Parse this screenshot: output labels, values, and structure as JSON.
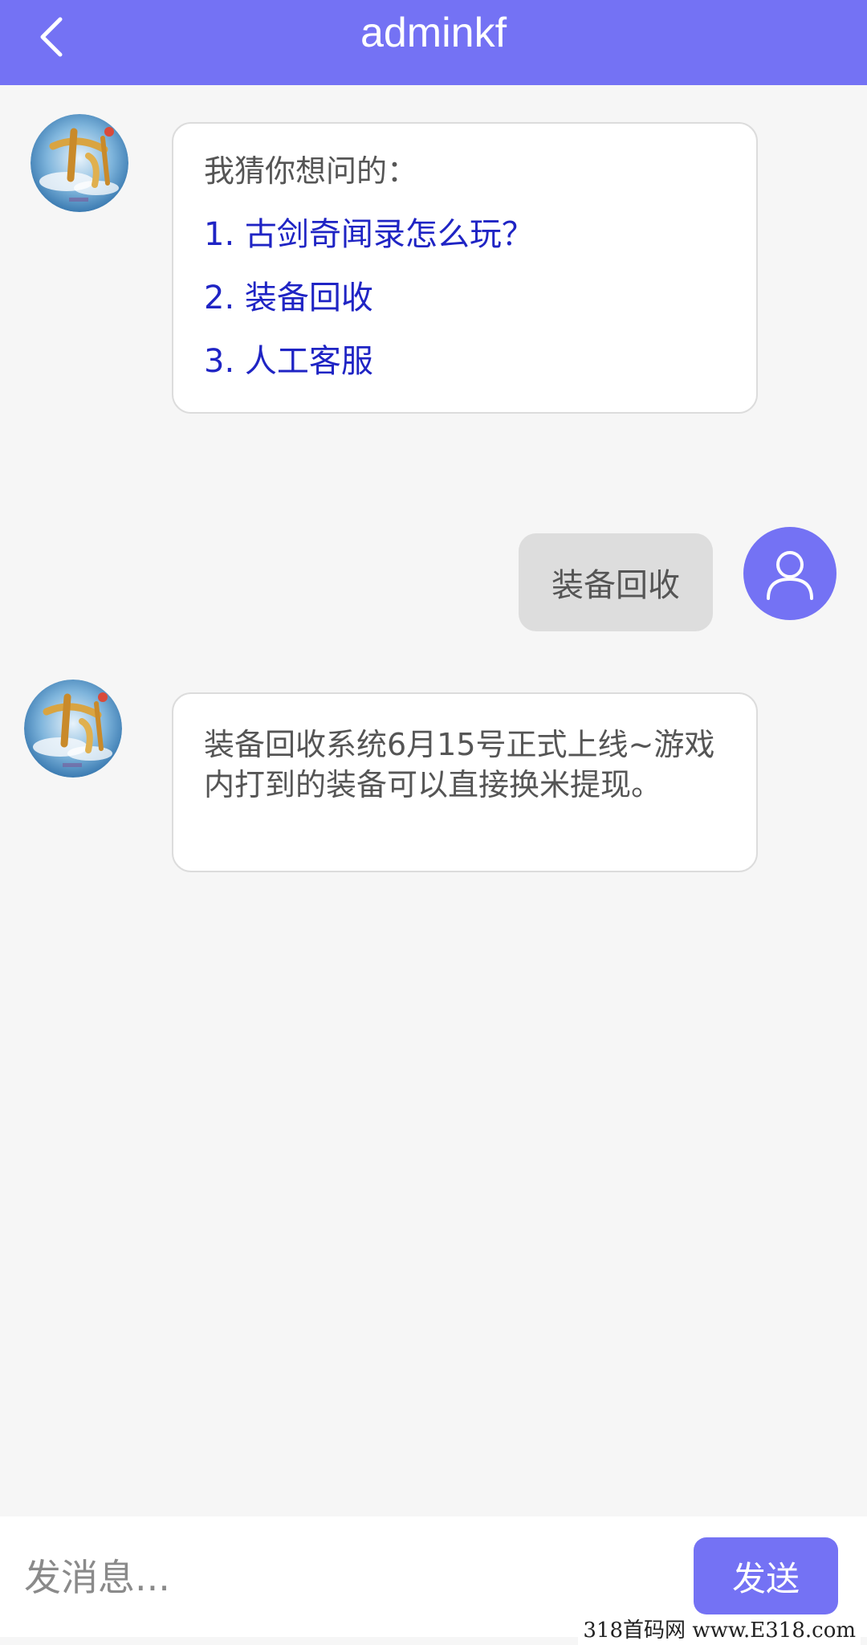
{
  "header": {
    "title": "adminkf",
    "back_icon": "chevron-left-icon"
  },
  "colors": {
    "accent": "#7472f4",
    "link": "#1f24c4",
    "background": "#f6f6f6",
    "user_bubble": "#dddddd"
  },
  "bot_avatar": {
    "logo_text": "古剑"
  },
  "messages": {
    "menu": {
      "intro": "我猜你想问的：",
      "items": [
        {
          "label": "1. 古剑奇闻录怎么玩？"
        },
        {
          "label": "2. 装备回收"
        },
        {
          "label": "3. 人工客服"
        }
      ]
    },
    "user": {
      "text": "装备回收",
      "avatar_icon": "user-icon"
    },
    "answer": {
      "text": "装备回收系统6月15号正式上线~游戏内打到的装备可以直接换米提现。"
    }
  },
  "composer": {
    "placeholder": "发消息...",
    "send_label": "发送"
  },
  "watermark": "318首码网 www.E318.com"
}
